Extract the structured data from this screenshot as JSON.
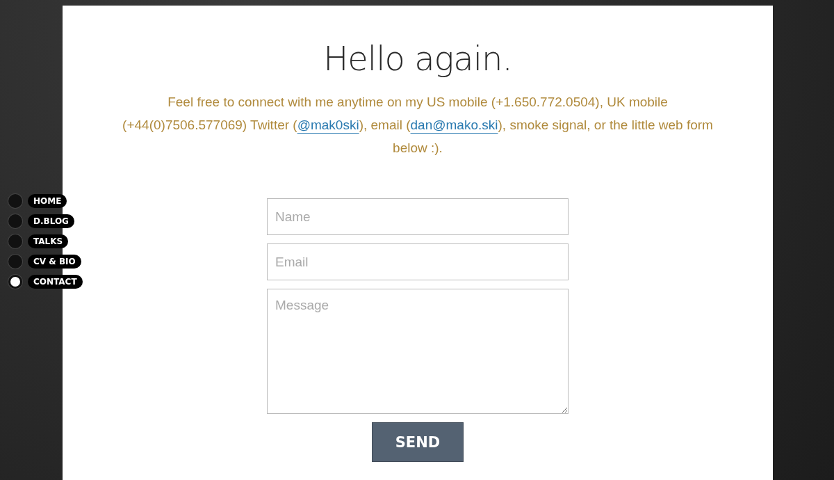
{
  "nav": [
    {
      "label": "HOME",
      "selected": false
    },
    {
      "label": "D.BLOG",
      "selected": false
    },
    {
      "label": "TALKS",
      "selected": false
    },
    {
      "label": "CV & BIO",
      "selected": false
    },
    {
      "label": "CONTACT",
      "selected": true
    }
  ],
  "heading": "Hello again.",
  "intro": [
    {
      "kind": "text",
      "text": "Feel free to connect with me anytime on my US mobile (+1.650.772.0504), UK mobile (+44(0)7506.577069) Twitter ("
    },
    {
      "kind": "link",
      "text": "@mak0ski"
    },
    {
      "kind": "text",
      "text": "), email ("
    },
    {
      "kind": "link",
      "text": "dan@mako.ski"
    },
    {
      "kind": "text",
      "text": "), smoke signal, or the little web form below :)."
    }
  ],
  "form": {
    "fields": [
      {
        "kind": "line",
        "placeholder": "Name"
      },
      {
        "kind": "line",
        "placeholder": "Email"
      },
      {
        "kind": "area",
        "placeholder": "Message"
      }
    ],
    "button": "SEND"
  }
}
